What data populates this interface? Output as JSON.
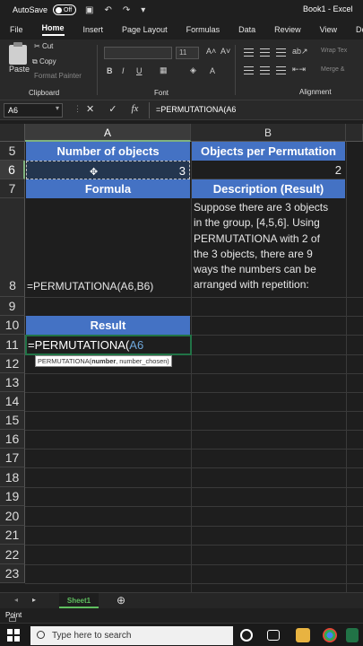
{
  "titlebar": {
    "autosave": "AutoSave",
    "toggle": "Off",
    "doc": "Book1 - Excel"
  },
  "ribbon_tabs": [
    "File",
    "Home",
    "Insert",
    "Page Layout",
    "Formulas",
    "Data",
    "Review",
    "View",
    "Develop"
  ],
  "ribbon": {
    "clipboard": {
      "paste": "Paste",
      "cut": "Cut",
      "copy": "Copy",
      "format_painter": "Format Painter",
      "label": "Clipboard"
    },
    "font": {
      "size": "11",
      "bold": "B",
      "italic": "I",
      "underline": "U",
      "label": "Font"
    },
    "alignment": {
      "wrap": "Wrap Tex",
      "merge": "Merge &",
      "label": "Alignment"
    }
  },
  "formula_bar": {
    "name_box": "A6",
    "cancel": "✕",
    "enter": "✓",
    "fx": "fx",
    "formula": "=PERMUTATIONA(A6"
  },
  "columns": [
    "A",
    "B"
  ],
  "rows": [
    "5",
    "6",
    "7",
    "8",
    "9",
    "10",
    "11",
    "12",
    "13",
    "14",
    "15",
    "16",
    "17",
    "18",
    "19",
    "20",
    "21",
    "22",
    "23"
  ],
  "cells": {
    "A5": "Number of objects",
    "B5": "Objects per Permutation",
    "A6": "3",
    "B6": "2",
    "A7": "Formula",
    "B7": "Description (Result)",
    "A8": "=PERMUTATIONA(A6,B6)",
    "B8": [
      "Suppose there are 3 objects",
      "in the group, [4,5,6]. Using",
      "PERMUTATIONA with 2 of",
      "the 3 objects, there are 9",
      "ways the numbers can be",
      "arranged with repetition:"
    ],
    "A10": "Result",
    "A11_prefix": "=PERMUTATIONA(",
    "A11_ref": "A6"
  },
  "tooltip": {
    "fn": "PERMUTATIONA(",
    "arg1": "number",
    "rest": ", number_chosen)"
  },
  "sheet_tab": "Sheet1",
  "status": "Point",
  "taskbar": {
    "search": "Type here to search"
  },
  "colors": {
    "header_fill": "#4472c4",
    "ref_blue": "#6fa8dc",
    "sheet_green": "#5fbf5f"
  }
}
